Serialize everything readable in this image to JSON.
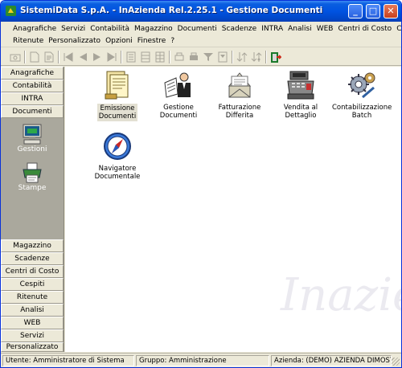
{
  "window": {
    "title": "SistemiData S.p.A. - InAzienda Rel.2.25.1 - Gestione Documenti",
    "minimize_label": "_",
    "maximize_label": "□",
    "close_label": "✕"
  },
  "menu": {
    "row1": [
      "Anagrafiche",
      "Servizi",
      "Contabilità",
      "Magazzino",
      "Documenti",
      "Scadenze",
      "INTRA",
      "Analisi",
      "WEB",
      "Centri di Costo",
      "Cespiti"
    ],
    "row2": [
      "Ritenute",
      "Personalizzato",
      "Opzioni",
      "Finestre",
      "?"
    ]
  },
  "toolbar": {
    "icons": [
      "camera-icon",
      "new-document-icon",
      "edit-document-icon",
      "first-record-icon",
      "previous-record-icon",
      "next-record-icon",
      "last-record-icon",
      "form-view-icon",
      "list-view-icon",
      "grid-view-icon",
      "print-preview-icon",
      "print-icon",
      "filter-icon",
      "filter-edit-icon",
      "sort-icon",
      "sort-advanced-icon",
      "exit-icon"
    ],
    "exit_color": "#cc2a1a"
  },
  "leftnav": {
    "top_buttons": [
      "Anagrafiche",
      "Contabilità",
      "INTRA",
      "Documenti"
    ],
    "panel_items": [
      {
        "label": "Gestioni",
        "icon": "computer-icon"
      },
      {
        "label": "Stampe",
        "icon": "printer-icon"
      }
    ],
    "bottom_buttons": [
      "Magazzino",
      "Scadenze",
      "Centri di Costo",
      "Cespiti",
      "Ritenute",
      "Analisi",
      "WEB",
      "Servizi",
      "Personalizzato"
    ]
  },
  "main": {
    "documents": [
      {
        "line1": "Emissione",
        "line2": "Documenti",
        "icon": "document-issue-icon",
        "selected": true
      },
      {
        "line1": "Gestione",
        "line2": "Documenti",
        "icon": "reader-icon",
        "selected": false
      },
      {
        "line1": "Fatturazione",
        "line2": "Differita",
        "icon": "envelope-icon",
        "selected": false
      },
      {
        "line1": "Vendita al",
        "line2": "Dettaglio",
        "icon": "cash-register-icon",
        "selected": false
      },
      {
        "line1": "Contabilizzazione",
        "line2": "Batch",
        "icon": "gears-icon",
        "selected": false
      },
      {
        "line1": "Navigatore",
        "line2": "Documentale",
        "icon": "compass-icon",
        "selected": false
      }
    ],
    "watermark": "Inazien"
  },
  "status": {
    "user": "Utente: Amministratore di Sistema",
    "group": "Gruppo: Amministrazione",
    "company": "Azienda: (DEMO) AZIENDA DIMOST"
  }
}
